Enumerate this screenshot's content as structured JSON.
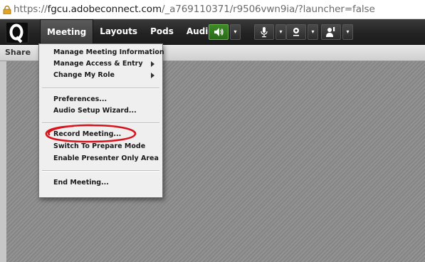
{
  "browser": {
    "url_prefix": "https://",
    "url_domain": "fgcu.adobeconnect.com",
    "url_path": "/_a769110371/r9506vwn9ia/?launcher=false"
  },
  "menubar": {
    "items": [
      {
        "label": "Meeting",
        "active": true
      },
      {
        "label": "Layouts",
        "active": false
      },
      {
        "label": "Pods",
        "active": false
      },
      {
        "label": "Audio",
        "active": false
      }
    ]
  },
  "toolbar": {
    "speaker_icon": "speaker-icon",
    "mic_icon": "microphone-icon",
    "camera_icon": "webcam-icon",
    "status_icon": "raise-hand-icon",
    "dropdown_glyph": "▾",
    "accent_green": "#3f8a28"
  },
  "pod": {
    "title": "Share"
  },
  "meeting_menu": {
    "items": [
      {
        "label": "Manage Meeting Information",
        "submenu": false
      },
      {
        "label": "Manage Access & Entry",
        "submenu": true
      },
      {
        "label": "Change My Role",
        "submenu": true
      },
      {
        "label": "Preferences...",
        "submenu": false
      },
      {
        "label": "Audio Setup Wizard...",
        "submenu": false
      },
      {
        "label": "Record Meeting...",
        "submenu": false
      },
      {
        "label": "Switch To Prepare Mode",
        "submenu": false
      },
      {
        "label": "Enable Presenter Only Area",
        "submenu": false
      },
      {
        "label": "End Meeting...",
        "submenu": false
      }
    ],
    "highlight_color": "#d9121b"
  }
}
